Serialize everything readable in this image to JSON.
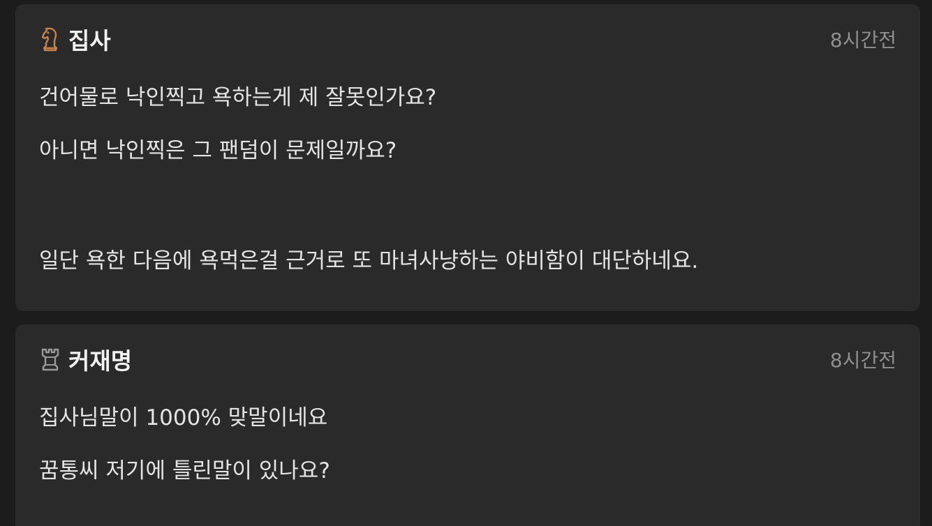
{
  "comments": [
    {
      "author": "집사",
      "time": "8시간전",
      "rank_icon": "knight-chess-icon",
      "rank_color": "#c8844a",
      "lines": [
        "건어물로 낙인찍고 욕하는게 제 잘못인가요?",
        "아니면 낙인찍은 그 팬덤이 문제일까요?",
        "",
        "일단 욕한 다음에 욕먹은걸 근거로 또 마녀사냥하는 야비함이 대단하네요."
      ]
    },
    {
      "author": "커재명",
      "time": "8시간전",
      "rank_icon": "rook-chess-icon",
      "rank_color": "#9a9a9a",
      "lines": [
        "집사님말이 1000% 맞말이네요",
        "꿈통씨 저기에 틀린말이 있나요?"
      ]
    }
  ]
}
